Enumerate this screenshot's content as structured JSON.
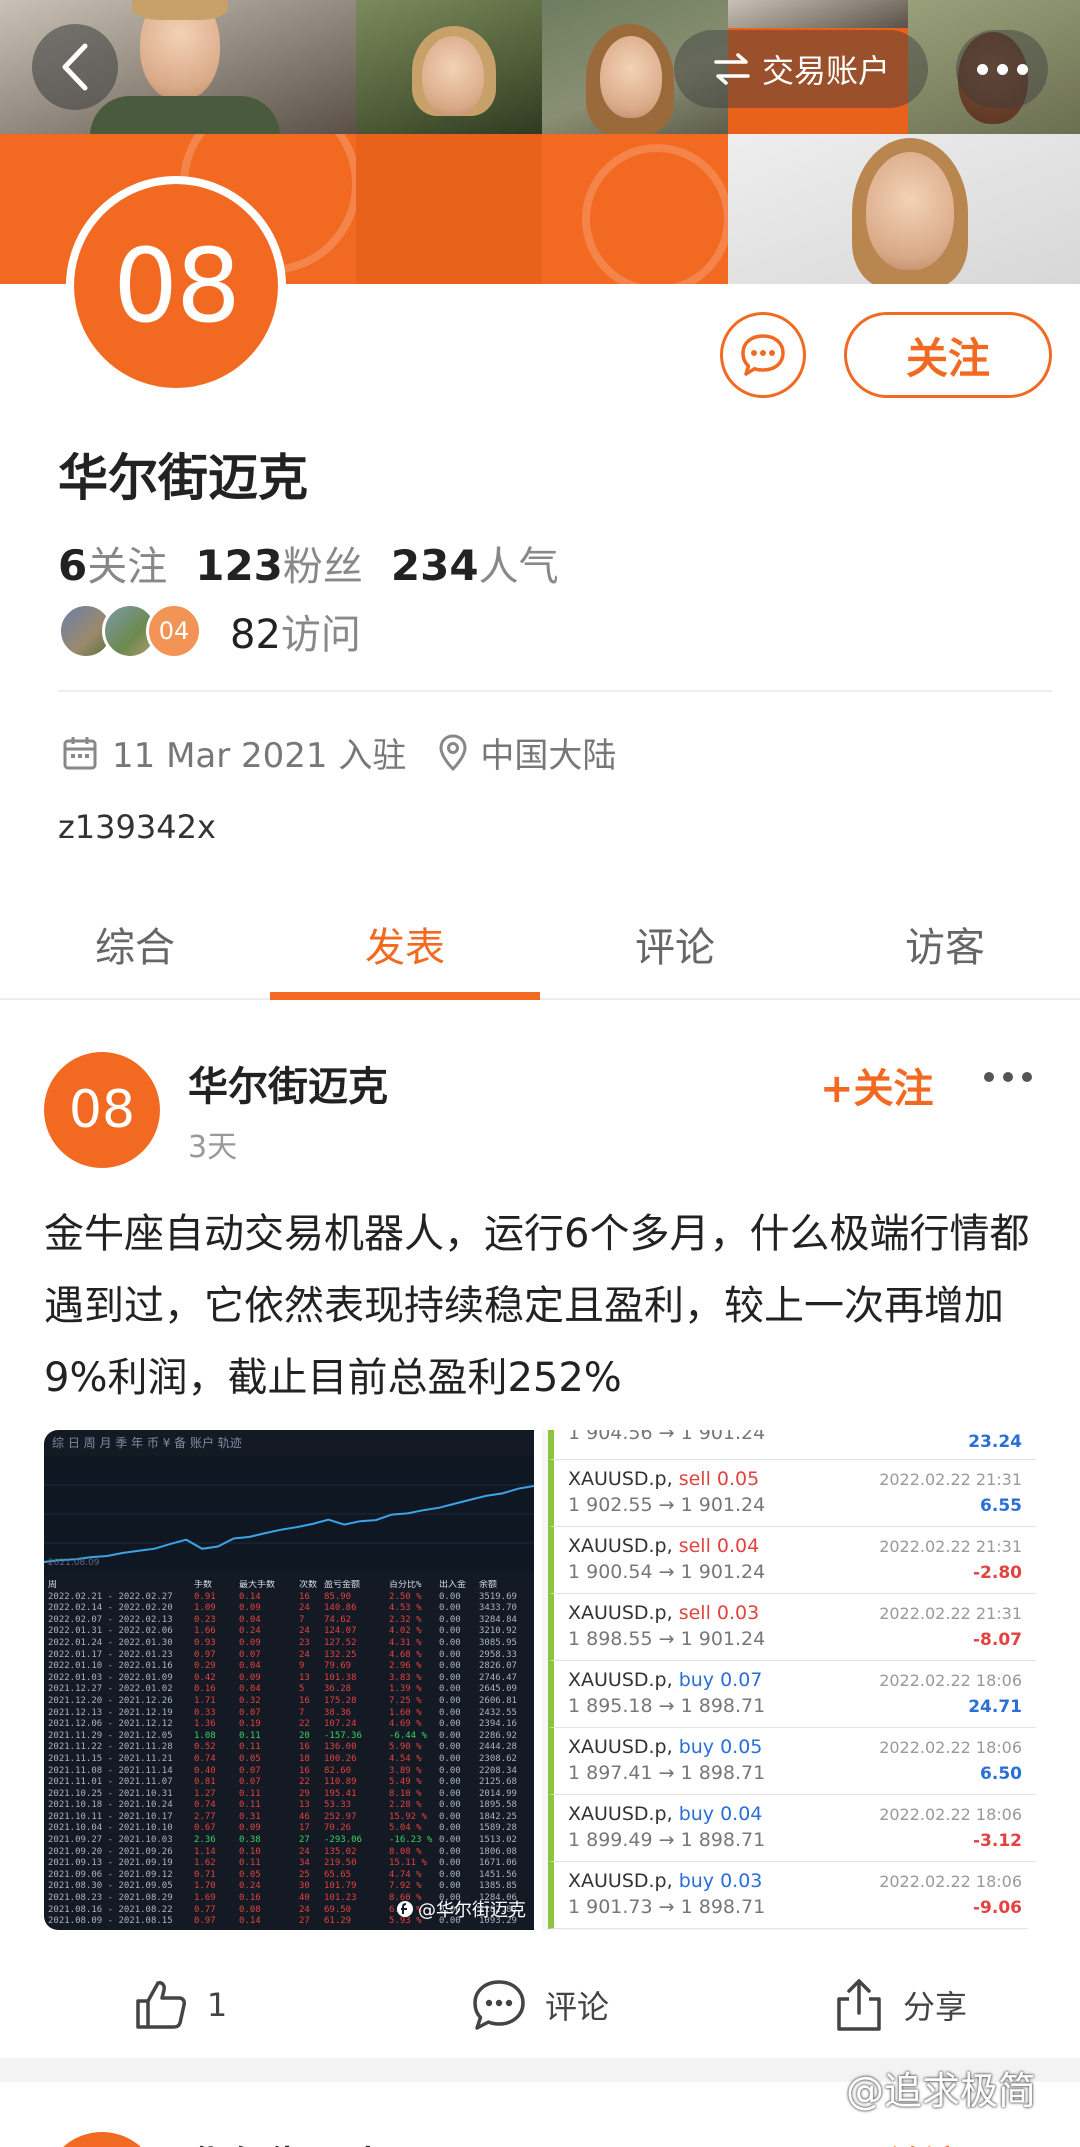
{
  "header": {
    "account_button_label": "交易账户",
    "colors": {
      "brand": "#f26a21"
    }
  },
  "profile": {
    "avatar_text": "08",
    "name": "华尔街迈克",
    "follow_label": "关注",
    "stats": {
      "following_count": "6",
      "following_label": "关注",
      "fans_count": "123",
      "fans_label": "粉丝",
      "popularity_count": "234",
      "popularity_label": "人气"
    },
    "visitor_avatar_text": "04",
    "visit_count": "82",
    "visit_label": "访问",
    "join_date": "11 Mar 2021 入驻",
    "location": "中国大陆",
    "bio": "z139342x"
  },
  "tabs": [
    {
      "label": "综合"
    },
    {
      "label": "发表"
    },
    {
      "label": "评论"
    },
    {
      "label": "访客"
    }
  ],
  "active_tab": "发表",
  "post": {
    "avatar_text": "08",
    "author": "华尔街迈克",
    "time": "3天",
    "follow_label": "+关注",
    "text": "金牛座自动交易机器人，运行6个多月，什么极端行情都遇到过，它依然表现持续稳定且盈利，较上一次再增加9%利润，截止目前总盈利252%",
    "image": {
      "left_toolbar": "综 日 周 月 季 年 币 ¥ 备 账户          轨迹",
      "left_date": "2021.08.09",
      "table_header": [
        "周",
        "手数",
        "最大手数",
        "次数",
        "盈亏金额",
        "百分比%",
        "出入金",
        "余额"
      ],
      "table_rows": [
        [
          "2022.02.21 - 2022.02.27",
          "0.91",
          "0.14",
          "16",
          "85.90",
          "2.50 %",
          "0.00",
          "3519.69"
        ],
        [
          "2022.02.14 - 2022.02.20",
          "1.09",
          "0.09",
          "24",
          "140.86",
          "4.53 %",
          "0.00",
          "3433.70"
        ],
        [
          "2022.02.07 - 2022.02.13",
          "0.23",
          "0.04",
          "7",
          "74.62",
          "2.32 %",
          "0.00",
          "3284.84"
        ],
        [
          "2022.01.31 - 2022.02.06",
          "1.66",
          "0.24",
          "24",
          "124.07",
          "4.02 %",
          "0.00",
          "3210.92"
        ],
        [
          "2022.01.24 - 2022.01.30",
          "0.93",
          "0.09",
          "23",
          "127.52",
          "4.31 %",
          "0.00",
          "3085.95"
        ],
        [
          "2022.01.17 - 2022.01.23",
          "0.97",
          "0.07",
          "24",
          "132.25",
          "4.68 %",
          "0.00",
          "2958.33"
        ],
        [
          "2022.01.10 - 2022.01.16",
          "0.29",
          "0.04",
          "9",
          "79.69",
          "2.96 %",
          "0.00",
          "2826.07"
        ],
        [
          "2022.01.03 - 2022.01.09",
          "0.42",
          "0.09",
          "13",
          "101.38",
          "3.83 %",
          "0.00",
          "2746.47"
        ],
        [
          "2021.12.27 - 2022.01.02",
          "0.16",
          "0.04",
          "5",
          "36.28",
          "1.39 %",
          "0.00",
          "2645.09"
        ],
        [
          "2021.12.20 - 2021.12.26",
          "1.71",
          "0.32",
          "16",
          "175.28",
          "7.25 %",
          "0.00",
          "2606.81"
        ],
        [
          "2021.12.13 - 2021.12.19",
          "0.33",
          "0.07",
          "7",
          "38.36",
          "1.60 %",
          "0.00",
          "2432.55"
        ],
        [
          "2021.12.06 - 2021.12.12",
          "1.36",
          "0.19",
          "22",
          "107.24",
          "4.69 %",
          "0.00",
          "2394.16"
        ],
        [
          "2021.11.29 - 2021.12.05",
          "1.08",
          "0.11",
          "20",
          "-157.36",
          "-6.44 %",
          "0.00",
          "2286.92"
        ],
        [
          "2021.11.22 - 2021.11.28",
          "0.52",
          "0.11",
          "16",
          "136.00",
          "5.90 %",
          "0.00",
          "2444.28"
        ],
        [
          "2021.11.15 - 2021.11.21",
          "0.74",
          "0.05",
          "18",
          "100.26",
          "4.54 %",
          "0.00",
          "2308.62"
        ],
        [
          "2021.11.08 - 2021.11.14",
          "0.40",
          "0.07",
          "16",
          "82.60",
          "3.89 %",
          "0.00",
          "2208.34"
        ],
        [
          "2021.11.01 - 2021.11.07",
          "0.81",
          "0.07",
          "22",
          "110.89",
          "5.49 %",
          "0.00",
          "2125.68"
        ],
        [
          "2021.10.25 - 2021.10.31",
          "1.27",
          "0.11",
          "29",
          "195.41",
          "8.10 %",
          "0.00",
          "2014.99"
        ],
        [
          "2021.10.18 - 2021.10.24",
          "0.74",
          "0.11",
          "13",
          "53.33",
          "2.28 %",
          "0.00",
          "1895.58"
        ],
        [
          "2021.10.11 - 2021.10.17",
          "2.77",
          "0.31",
          "46",
          "252.97",
          "15.92 %",
          "0.00",
          "1842.25"
        ],
        [
          "2021.10.04 - 2021.10.10",
          "0.67",
          "0.09",
          "17",
          "70.26",
          "5.04 %",
          "0.00",
          "1589.28"
        ],
        [
          "2021.09.27 - 2021.10.03",
          "2.36",
          "0.38",
          "27",
          "-293.06",
          "-16.23 %",
          "0.00",
          "1513.02"
        ],
        [
          "2021.09.20 - 2021.09.26",
          "1.14",
          "0.10",
          "24",
          "135.02",
          "8.08 %",
          "0.00",
          "1806.08"
        ],
        [
          "2021.09.13 - 2021.09.19",
          "1.62",
          "0.11",
          "34",
          "219.50",
          "15.11 %",
          "0.00",
          "1671.06"
        ],
        [
          "2021.09.06 - 2021.09.12",
          "0.71",
          "0.05",
          "25",
          "65.65",
          "4.74 %",
          "0.00",
          "1451.56"
        ],
        [
          "2021.08.30 - 2021.09.05",
          "1.70",
          "0.24",
          "30",
          "101.79",
          "7.92 %",
          "0.00",
          "1385.85"
        ],
        [
          "2021.08.23 - 2021.08.29",
          "1.69",
          "0.16",
          "40",
          "101.23",
          "8.60 %",
          "0.00",
          "1284.06"
        ],
        [
          "2021.08.16 - 2021.08.22",
          "0.77",
          "0.08",
          "24",
          "69.50",
          "6.15 %",
          "0.00",
          "1182.83"
        ],
        [
          "2021.08.09 - 2021.08.15",
          "0.97",
          "0.14",
          "27",
          "61.29",
          "5.93 %",
          "0.00",
          "1093.29"
        ]
      ],
      "watermark": "@华尔街迈克",
      "equity_curve": [
        1093,
        1154,
        1182,
        1251,
        1284,
        1385,
        1451,
        1517,
        1671,
        1806,
        1513,
        1589,
        1842,
        1895,
        2014,
        2125,
        2208,
        2308,
        2444,
        2286,
        2394,
        2432,
        2606,
        2645,
        2746,
        2826,
        2958,
        3085,
        3210,
        3284,
        3433,
        3519
      ],
      "trades_partial_top": {
        "price": "1 904.56 → 1 901.24",
        "profit": "23.24"
      },
      "trades": [
        {
          "symbol": "XAUUSD.p,",
          "side": "sell",
          "lots": "0.05",
          "price": "1 902.55 → 1 901.24",
          "date": "2022.02.22 21:31",
          "profit": "6.55",
          "sign": "pos"
        },
        {
          "symbol": "XAUUSD.p,",
          "side": "sell",
          "lots": "0.04",
          "price": "1 900.54 → 1 901.24",
          "date": "2022.02.22 21:31",
          "profit": "-2.80",
          "sign": "neg"
        },
        {
          "symbol": "XAUUSD.p,",
          "side": "sell",
          "lots": "0.03",
          "price": "1 898.55 → 1 901.24",
          "date": "2022.02.22 21:31",
          "profit": "-8.07",
          "sign": "neg"
        },
        {
          "symbol": "XAUUSD.p,",
          "side": "buy",
          "lots": "0.07",
          "price": "1 895.18 → 1 898.71",
          "date": "2022.02.22 18:06",
          "profit": "24.71",
          "sign": "pos"
        },
        {
          "symbol": "XAUUSD.p,",
          "side": "buy",
          "lots": "0.05",
          "price": "1 897.41 → 1 898.71",
          "date": "2022.02.22 18:06",
          "profit": "6.50",
          "sign": "pos"
        },
        {
          "symbol": "XAUUSD.p,",
          "side": "buy",
          "lots": "0.04",
          "price": "1 899.49 → 1 898.71",
          "date": "2022.02.22 18:06",
          "profit": "-3.12",
          "sign": "neg"
        },
        {
          "symbol": "XAUUSD.p,",
          "side": "buy",
          "lots": "0.03",
          "price": "1 901.73 → 1 898.71",
          "date": "2022.02.22 18:06",
          "profit": "-9.06",
          "sign": "neg"
        }
      ]
    },
    "actions": {
      "like_count": "1",
      "comment_label": "评论",
      "share_label": "分享"
    }
  },
  "corner_watermark": "@追求极简",
  "next_post": {
    "author": "华尔街迈克",
    "follow_label": "+关注"
  }
}
